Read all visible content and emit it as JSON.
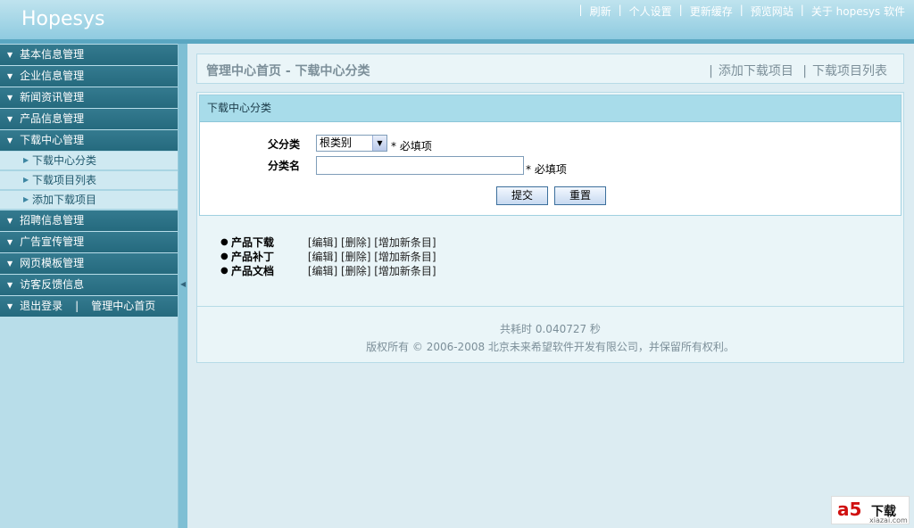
{
  "header": {
    "logo": "Hopesys",
    "links": [
      "刷新",
      "个人设置",
      "更新缓存",
      "预览网站",
      "关于 hopesys 软件"
    ]
  },
  "sidebar": {
    "menus": [
      {
        "label": "基本信息管理"
      },
      {
        "label": "企业信息管理"
      },
      {
        "label": "新闻资讯管理"
      },
      {
        "label": "产品信息管理"
      },
      {
        "label": "下载中心管理"
      }
    ],
    "sub_items": [
      "下载中心分类",
      "下载项目列表",
      "添加下载项目"
    ],
    "menus_after": [
      {
        "label": "招聘信息管理"
      },
      {
        "label": "广告宣传管理"
      },
      {
        "label": "网页模板管理"
      },
      {
        "label": "访客反馈信息"
      }
    ],
    "logout": "退出登录",
    "home": "管理中心首页"
  },
  "breadcrumb": {
    "text": "管理中心首页 - 下载中心分类",
    "link_add": "添加下载项目",
    "link_list": "下载项目列表"
  },
  "form": {
    "title": "下载中心分类",
    "parent_label": "父分类",
    "parent_value": "根类别",
    "required": "* 必填项",
    "name_label": "分类名",
    "name_value": "",
    "submit": "提交",
    "reset": "重置"
  },
  "categories": [
    {
      "name": "产品下载",
      "edit": "[编辑]",
      "delete": "[删除]",
      "add": "[增加新条目]"
    },
    {
      "name": "产品补丁",
      "edit": "[编辑]",
      "delete": "[删除]",
      "add": "[增加新条目]"
    },
    {
      "name": "产品文档",
      "edit": "[编辑]",
      "delete": "[删除]",
      "add": "[增加新条目]"
    }
  ],
  "footer": {
    "time": "共耗时 0.040727 秒",
    "copyright": "版权所有 © 2006-2008 北京未来希望软件开发有限公司，并保留所有权利。"
  },
  "watermark": {
    "brand": "a5",
    "text": "下载",
    "url": "xiazai.com"
  }
}
